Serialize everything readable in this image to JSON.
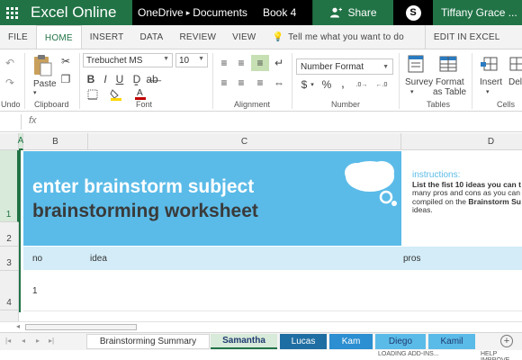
{
  "titlebar": {
    "app_name": "Excel Online",
    "location": "OneDrive",
    "folder": "Documents",
    "workbook": "Book 4",
    "share_label": "Share",
    "user_name": "Tiffany Grace ..."
  },
  "tabs": [
    "FILE",
    "HOME",
    "INSERT",
    "DATA",
    "REVIEW",
    "VIEW"
  ],
  "active_tab": "HOME",
  "tell_me": "Tell me what you want to do",
  "edit_in_excel": "EDIT IN EXCEL",
  "ribbon": {
    "undo": "Undo",
    "paste": "Paste",
    "clipboard": "Clipboard",
    "font_name": "Trebuchet MS",
    "font_size": "10",
    "font_group": "Font",
    "alignment": "Alignment",
    "number_format": "Number Format",
    "number_group": "Number",
    "survey": "Survey",
    "format_as_table_1": "Format",
    "format_as_table_2": "as Table",
    "tables": "Tables",
    "insert": "Insert",
    "delete": "Dele",
    "cells": "Cells",
    "currency": "$",
    "percent": "%",
    "comma": ","
  },
  "grid": {
    "columns": [
      "A",
      "B",
      "C",
      "D"
    ],
    "rows": [
      "1",
      "2",
      "3",
      "4"
    ],
    "banner_title": "enter brainstorm subject",
    "banner_subtitle": "brainstorming worksheet",
    "instructions_title": "instructions:",
    "instructions_line1": "List the fist 10 ideas you can t",
    "instructions_line2": "many pros and cons as you can",
    "instructions_line3_pre": "compiled on the ",
    "instructions_line3_bold": "Brainstorm Su",
    "instructions_line4": "ideas.",
    "col_no": "no",
    "col_idea": "idea",
    "col_pros": "pros",
    "first_no": "1"
  },
  "sheets": [
    {
      "name": "Brainstorming Summary",
      "color": "#ffffff"
    },
    {
      "name": "Samantha",
      "color": "#d8ead9"
    },
    {
      "name": "Lucas",
      "color": "#1f6ea3"
    },
    {
      "name": "Kam",
      "color": "#2b8fd1"
    },
    {
      "name": "Diego",
      "color": "#5bbbe8"
    },
    {
      "name": "Kamil",
      "color": "#5bbbe8"
    }
  ],
  "active_sheet": "Samantha",
  "status": {
    "left": "LOADING ADD-INS...",
    "right": "HELP IMPROVE"
  },
  "colors": {
    "brand_green": "#217346",
    "banner_blue": "#5bbbe8",
    "header_row_blue": "#d3ecf8"
  }
}
